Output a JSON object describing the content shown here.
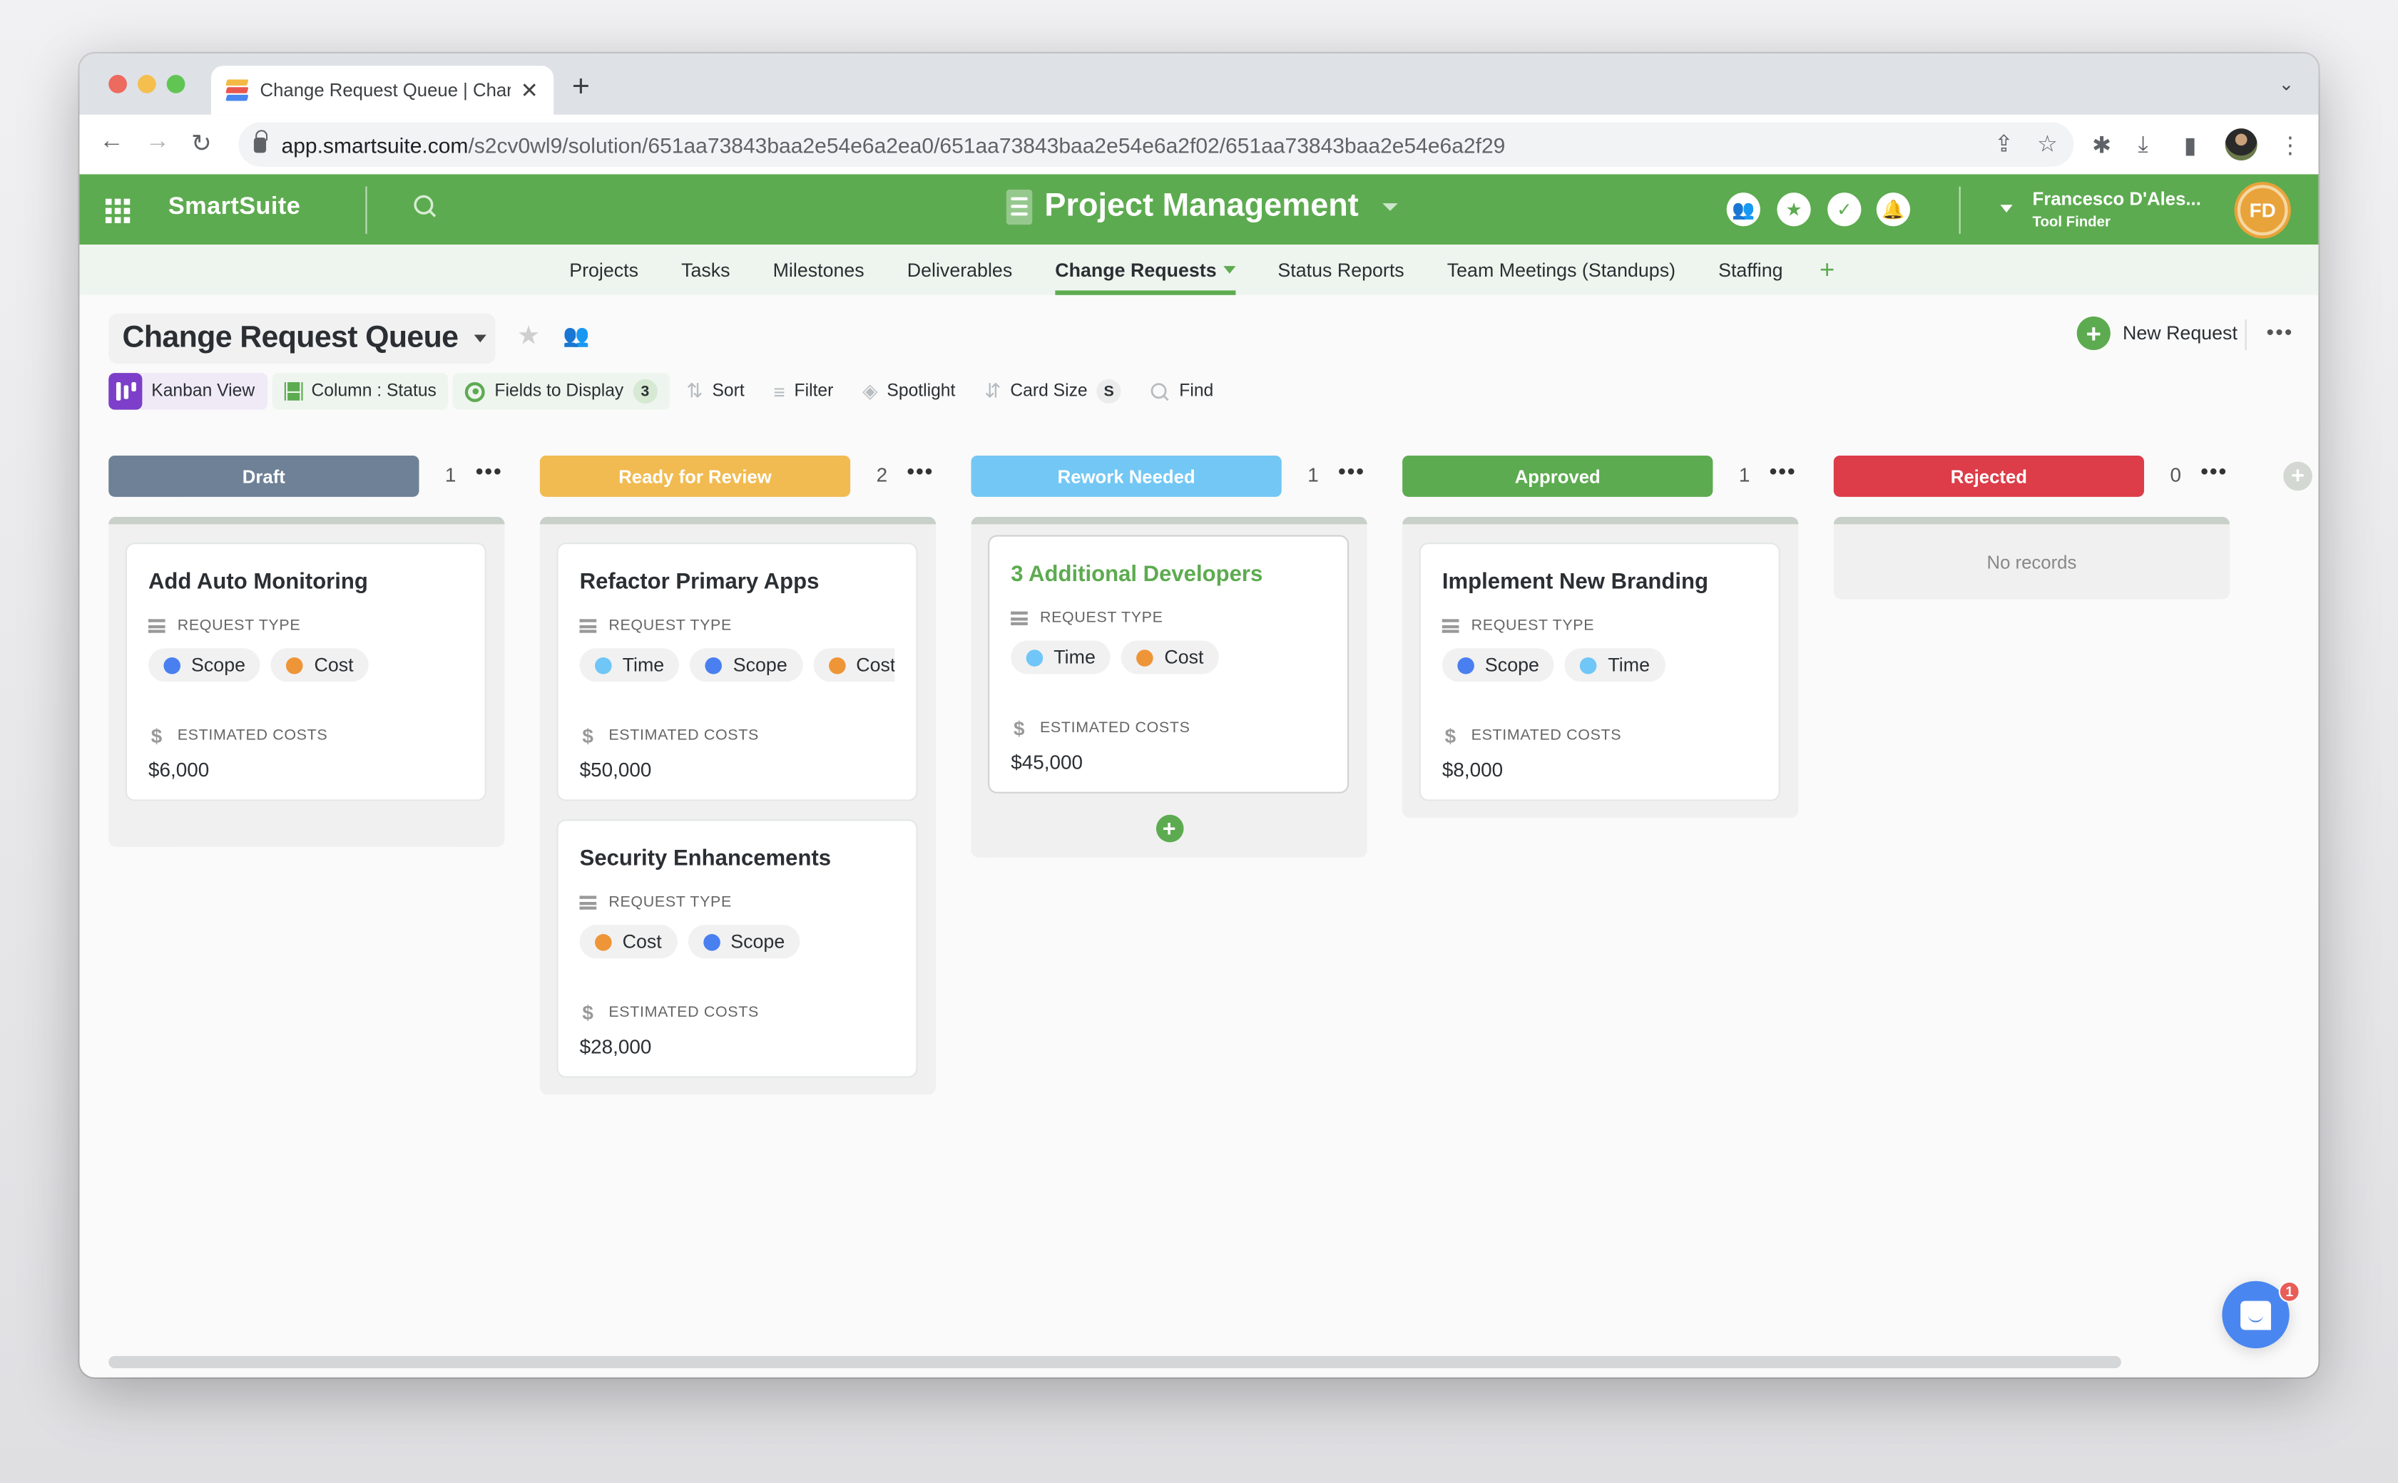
{
  "browser": {
    "tab_title": "Change Request Queue | Char",
    "url_host": "app.smartsuite.com",
    "url_path": "/s2cv0wl9/solution/651aa73843baa2e54e6a2ea0/651aa73843baa2e54e6a2f02/651aa73843baa2e54e6a2f29",
    "new_tab_label": "+",
    "close_label": "✕"
  },
  "app": {
    "brand": "SmartSuite",
    "solution_title": "Project Management",
    "user_name": "Francesco D'Ales...",
    "user_org": "Tool Finder",
    "avatar_initials": "FD",
    "header_icons": [
      "members-icon",
      "favorites-icon",
      "tasks-check-icon",
      "notifications-bell-icon"
    ]
  },
  "subnav": {
    "items": [
      {
        "label": "Projects"
      },
      {
        "label": "Tasks"
      },
      {
        "label": "Milestones"
      },
      {
        "label": "Deliverables"
      },
      {
        "label": "Change Requests",
        "active": true
      },
      {
        "label": "Status Reports"
      },
      {
        "label": "Team Meetings (Standups)"
      },
      {
        "label": "Staffing"
      }
    ],
    "add_label": "+"
  },
  "view": {
    "title": "Change Request Queue",
    "new_request_label": "New Request",
    "more_label": "•••"
  },
  "toolbar": {
    "kanban": "Kanban View",
    "column": "Column : Status",
    "fields": "Fields to Display",
    "fields_count": "3",
    "sort": "Sort",
    "filter": "Filter",
    "spotlight": "Spotlight",
    "card_size": "Card Size",
    "card_size_value": "S",
    "find": "Find"
  },
  "labels": {
    "request_type": "REQUEST TYPE",
    "estimated_costs": "ESTIMATED COSTS",
    "no_records": "No records",
    "more": "•••"
  },
  "colors": {
    "brand_green": "#5dab50",
    "draft": "#6e8196",
    "ready": "#f1bb52",
    "rework": "#73c7f4",
    "approved": "#5dab50",
    "rejected": "#dc3d48",
    "tag_scope": "#4a7ff0",
    "tag_cost": "#ee9538",
    "tag_time": "#6fc6f7"
  },
  "columns": [
    {
      "name": "Draft",
      "count": "1",
      "color": "#6e8196",
      "cards": [
        {
          "title": "Add Auto Monitoring",
          "tags": [
            "Scope",
            "Cost"
          ],
          "cost": "$6,000"
        }
      ]
    },
    {
      "name": "Ready for Review",
      "count": "2",
      "color": "#f1bb52",
      "cards": [
        {
          "title": "Refactor Primary Apps",
          "tags": [
            "Time",
            "Scope",
            "Cost"
          ],
          "cost": "$50,000"
        },
        {
          "title": "Security Enhancements",
          "tags": [
            "Cost",
            "Scope"
          ],
          "cost": "$28,000"
        }
      ]
    },
    {
      "name": "Rework Needed",
      "count": "1",
      "color": "#73c7f4",
      "show_add": true,
      "cards": [
        {
          "title": "3 Additional Developers",
          "tags": [
            "Time",
            "Cost"
          ],
          "cost": "$45,000",
          "highlight": true
        }
      ]
    },
    {
      "name": "Approved",
      "count": "1",
      "color": "#5dab50",
      "cards": [
        {
          "title": "Implement New Branding",
          "tags": [
            "Scope",
            "Time"
          ],
          "cost": "$8,000"
        }
      ]
    },
    {
      "name": "Rejected",
      "count": "0",
      "color": "#dc3d48",
      "cards": []
    }
  ],
  "chat": {
    "badge": "1"
  }
}
